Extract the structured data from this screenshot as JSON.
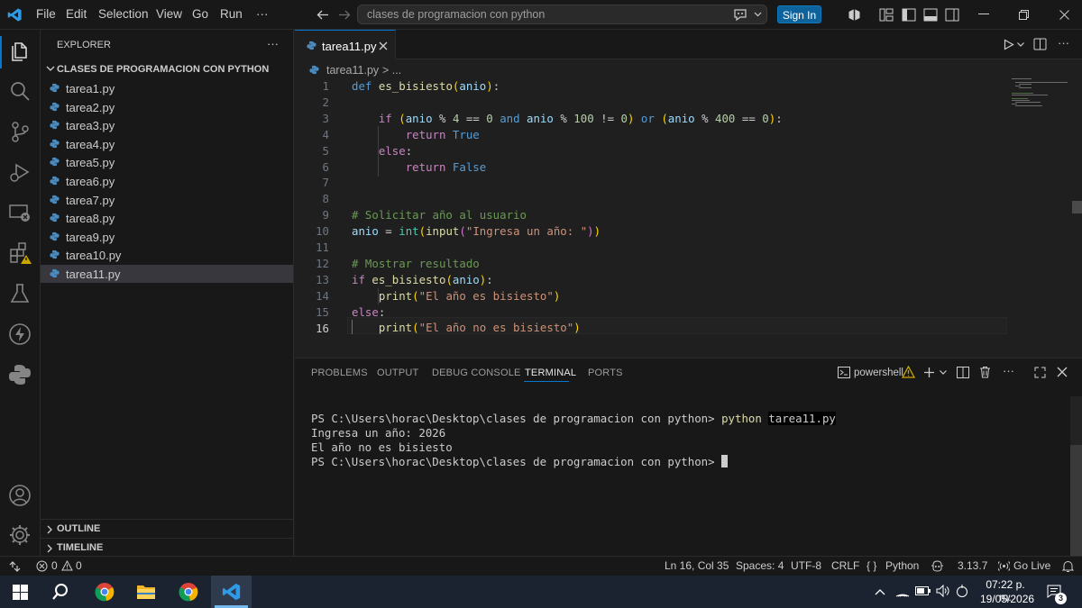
{
  "titlebar": {
    "menu": [
      "File",
      "Edit",
      "Selection",
      "View",
      "Go",
      "Run"
    ],
    "more": "···",
    "search_text": "clases de programacion con python",
    "sign_in": "Sign In"
  },
  "sidebar": {
    "title": "EXPLORER",
    "more": "···",
    "folder": "CLASES DE PROGRAMACION CON PYTHON",
    "files": [
      "tarea1.py",
      "tarea2.py",
      "tarea3.py",
      "tarea4.py",
      "tarea5.py",
      "tarea6.py",
      "tarea7.py",
      "tarea8.py",
      "tarea9.py",
      "tarea10.py",
      "tarea11.py"
    ],
    "selected": "tarea11.py",
    "outline": "OUTLINE",
    "timeline": "TIMELINE"
  },
  "editor": {
    "tab": "tarea11.py",
    "breadcrumb_file": "tarea11.py",
    "breadcrumb_more": "> ...",
    "line_numbers": [
      "1",
      "2",
      "3",
      "4",
      "5",
      "6",
      "7",
      "8",
      "9",
      "10",
      "11",
      "12",
      "13",
      "14",
      "15",
      "16"
    ],
    "active_line": "16"
  },
  "panel": {
    "tabs": [
      "PROBLEMS",
      "OUTPUT",
      "DEBUG CONSOLE",
      "TERMINAL",
      "PORTS"
    ],
    "active_tab": "TERMINAL",
    "shell": "powershell",
    "prompt": "PS C:\\Users\\horac\\Desktop\\clases de programacion con python>",
    "cmd_python": "python",
    "cmd_file": "tarea11.py",
    "output_1": "Ingresa un año: 2026",
    "output_2": "El año no es bisiesto"
  },
  "status": {
    "errors": "0",
    "warnings": "0",
    "position": "Ln 16, Col 35",
    "spaces": "Spaces: 4",
    "encoding": "UTF-8",
    "eol": "CRLF",
    "language_brackets": "{ }",
    "language": "Python",
    "version": "3.13.7",
    "go_live": "Go Live"
  },
  "taskbar": {
    "time": "07:22 p. m.",
    "date": "19/05/2026",
    "notifications": "3"
  },
  "colors": {
    "accent": "#0078d4",
    "keyword": "#569cd6",
    "control": "#c586c0",
    "function": "#dcdcaa",
    "variable": "#9cdcfe",
    "number": "#b5cea8",
    "string": "#ce9178",
    "comment": "#6a9955"
  }
}
